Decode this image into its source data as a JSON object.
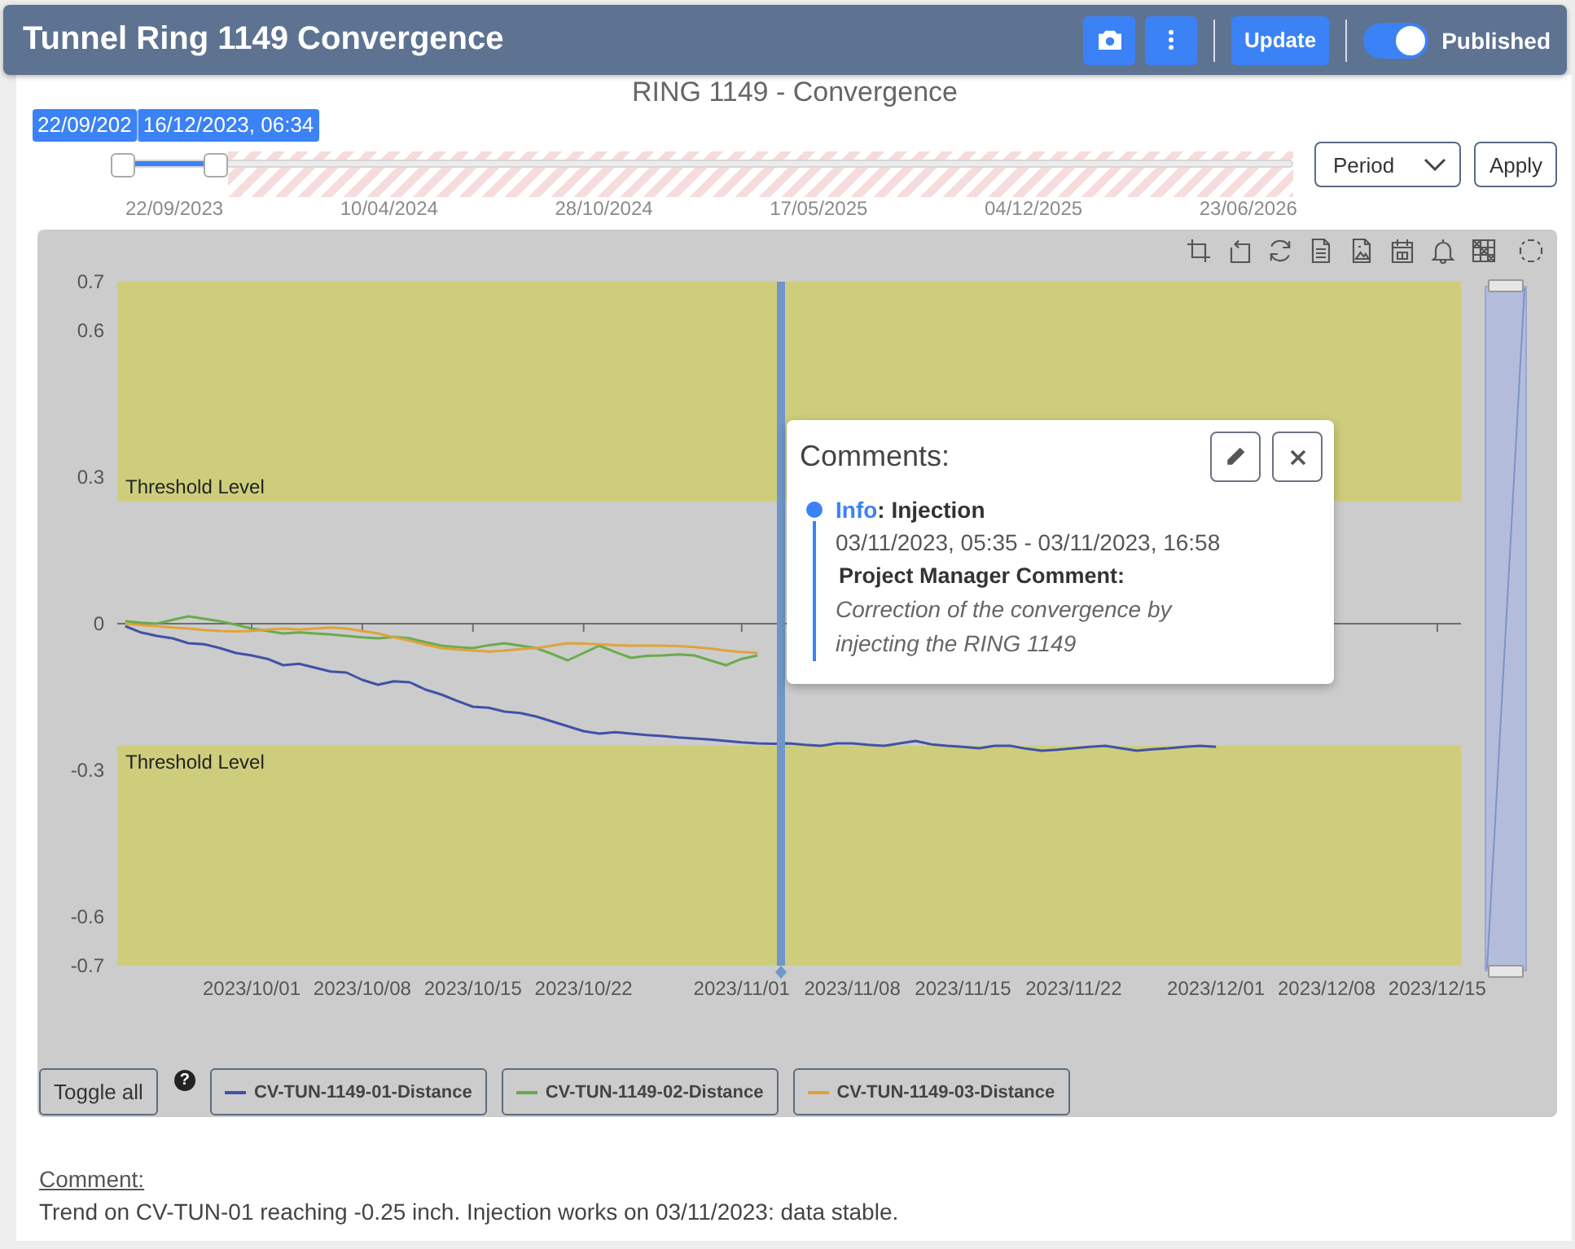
{
  "header": {
    "title": "Tunnel Ring 1149 Convergence",
    "update_button": "Update",
    "published": {
      "label": "Published",
      "on": true
    }
  },
  "chart": {
    "range_slider": {
      "handle_labels": [
        "22/09/202",
        "16/12/2023, 06:34"
      ],
      "level": 0.08,
      "ticks": [
        "22/09/2023",
        "10/04/2024",
        "28/10/2024",
        "17/05/2025",
        "04/12/2025",
        "23/06/2026"
      ]
    },
    "period_select": {
      "value": "Period"
    },
    "apply_button": "Apply",
    "chart_data": {
      "type": "line",
      "title": "RING 1149 - Convergence",
      "categories": [
        null,
        null,
        null,
        null,
        null,
        null,
        null,
        null,
        "2023/10/01",
        null,
        null,
        null,
        null,
        null,
        null,
        "2023/10/08",
        null,
        null,
        null,
        null,
        null,
        null,
        "2023/10/15",
        null,
        null,
        null,
        null,
        null,
        null,
        "2023/10/22",
        null,
        null,
        null,
        null,
        null,
        null,
        null,
        null,
        null,
        "2023/11/01",
        null,
        null,
        null,
        null,
        null,
        null,
        "2023/11/08",
        null,
        null,
        null,
        null,
        null,
        null,
        "2023/11/15",
        null,
        null,
        null,
        null,
        null,
        null,
        "2023/11/22",
        null,
        null,
        null,
        null,
        null,
        null,
        null,
        null,
        "2023/12/01",
        null,
        null,
        null,
        null,
        null,
        null,
        "2023/12/08",
        null,
        null,
        null,
        null,
        null,
        null,
        "2023/12/15",
        null
      ],
      "series": [
        {
          "name": "CV-TUN-1149-01-Distance",
          "color": "#4151a8",
          "values": [
            -0.005,
            -0.018,
            -0.025,
            -0.03,
            -0.04,
            -0.042,
            -0.05,
            -0.06,
            -0.065,
            -0.072,
            -0.085,
            -0.082,
            -0.09,
            -0.098,
            -0.1,
            -0.115,
            -0.125,
            -0.118,
            -0.12,
            -0.135,
            -0.145,
            -0.158,
            -0.17,
            -0.172,
            -0.18,
            -0.183,
            -0.19,
            -0.2,
            -0.21,
            -0.22,
            -0.225,
            -0.222,
            -0.225,
            -0.228,
            -0.23,
            -0.233,
            -0.235,
            -0.237,
            -0.24,
            -0.243,
            -0.245,
            -0.246,
            -0.245,
            -0.248,
            -0.25,
            -0.245,
            -0.245,
            -0.248,
            -0.25,
            -0.245,
            -0.24,
            -0.247,
            -0.25,
            -0.252,
            -0.255,
            -0.25,
            -0.25,
            -0.256,
            -0.26,
            -0.258,
            -0.255,
            -0.252,
            -0.25,
            -0.255,
            -0.26,
            -0.257,
            -0.255,
            -0.252,
            -0.25,
            -0.252,
            null,
            null,
            null,
            null,
            null,
            null,
            null,
            null,
            null,
            null,
            null,
            null,
            null,
            null,
            null
          ]
        },
        {
          "name": "CV-TUN-1149-02-Distance",
          "color": "#6aab4d",
          "values": [
            0.005,
            0.002,
            0,
            0.008,
            0.015,
            0.01,
            0.005,
            -0.002,
            -0.01,
            -0.015,
            -0.02,
            -0.018,
            -0.02,
            -0.022,
            -0.025,
            -0.028,
            -0.03,
            -0.027,
            -0.03,
            -0.038,
            -0.045,
            -0.048,
            -0.05,
            -0.044,
            -0.04,
            -0.045,
            -0.05,
            -0.062,
            -0.075,
            -0.06,
            -0.045,
            -0.058,
            -0.07,
            -0.066,
            -0.065,
            -0.063,
            -0.065,
            -0.075,
            -0.085,
            -0.072,
            -0.065,
            null,
            null,
            null,
            null,
            null,
            null,
            null,
            null,
            null,
            null,
            null,
            null,
            null,
            null,
            null,
            null,
            null,
            null,
            null,
            null,
            null,
            null,
            null,
            null,
            null,
            null,
            null,
            null,
            null,
            null,
            null,
            null,
            null,
            null,
            null,
            null,
            null,
            null,
            null,
            null,
            null,
            null,
            null,
            null
          ]
        },
        {
          "name": "CV-TUN-1149-03-Distance",
          "color": "#e0a33a",
          "values": [
            0,
            -0.003,
            -0.005,
            -0.008,
            -0.01,
            -0.013,
            -0.015,
            -0.016,
            -0.015,
            -0.012,
            -0.01,
            -0.012,
            -0.01,
            -0.008,
            -0.01,
            -0.015,
            -0.02,
            -0.028,
            -0.035,
            -0.043,
            -0.05,
            -0.053,
            -0.055,
            -0.057,
            -0.055,
            -0.052,
            -0.05,
            -0.045,
            -0.04,
            -0.041,
            -0.042,
            -0.044,
            -0.045,
            -0.045,
            -0.045,
            -0.046,
            -0.048,
            -0.051,
            -0.055,
            -0.058,
            -0.06,
            null,
            null,
            null,
            null,
            null,
            null,
            null,
            null,
            null,
            null,
            null,
            null,
            null,
            null,
            null,
            null,
            null,
            null,
            null,
            null,
            null,
            null,
            null,
            null,
            null,
            null,
            null,
            null,
            null,
            null,
            null,
            null,
            null,
            null,
            null,
            null,
            null,
            null,
            null,
            null,
            null,
            null,
            null,
            null
          ]
        }
      ],
      "ylim": [
        -0.7,
        0.7
      ],
      "yticks": [
        0.7,
        0.6,
        0.3,
        0,
        -0.3,
        -0.6,
        -0.7
      ],
      "bands": [
        {
          "axis": "y",
          "from": 0.25,
          "to": 0.7,
          "label": "Threshold Level"
        },
        {
          "axis": "y",
          "from": -0.25,
          "to": -0.7,
          "label": "Threshold Level"
        }
      ]
    },
    "comments_popup": {
      "title": "Comments:",
      "items": [
        {
          "category": "Info",
          "heading": ": Injection",
          "period": "03/11/2023, 05:35 - 03/11/2023, 16:58",
          "author": "Project Manager Comment:",
          "body": "Correction of the convergence by injecting the RING 1149"
        }
      ]
    },
    "legend": {
      "toggle_all": "Toggle all",
      "help": "?"
    }
  },
  "comment": {
    "label": "Comment:",
    "text": "Trend on CV-TUN-01 reaching -0.25 inch. Injection works on 03/11/2023: data stable."
  }
}
